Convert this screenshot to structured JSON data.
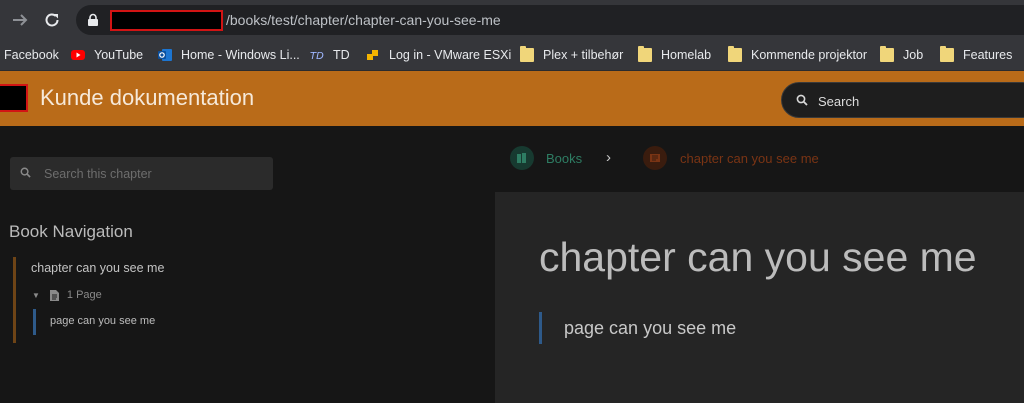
{
  "browser": {
    "url_path": "/books/test/chapter/chapter-can-you-see-me",
    "bookmarks": [
      {
        "label": "Facebook",
        "icon": "none"
      },
      {
        "label": "YouTube",
        "icon": "youtube-icon"
      },
      {
        "label": "Home - Windows Li...",
        "icon": "outlook-icon"
      },
      {
        "label": "TD",
        "icon": "td-icon"
      },
      {
        "label": "Log in - VMware ESXi",
        "icon": "vmware-icon"
      },
      {
        "label": "Plex + tilbehør",
        "icon": "folder-icon"
      },
      {
        "label": "Homelab",
        "icon": "folder-icon"
      },
      {
        "label": "Kommende projektor",
        "icon": "folder-icon"
      },
      {
        "label": "Job",
        "icon": "folder-icon"
      },
      {
        "label": "Features",
        "icon": "folder-icon"
      }
    ]
  },
  "header": {
    "title": "Kunde dokumentation",
    "search_placeholder": "Search",
    "accent_color": "#b96b19"
  },
  "sidebar": {
    "search_placeholder": "Search this chapter",
    "nav_title": "Book Navigation",
    "chapter_label": "chapter can you see me",
    "page_count": "1 Page",
    "page_label": "page can you see me"
  },
  "breadcrumb": {
    "books_label": "Books",
    "chapter_label": "chapter can you see me"
  },
  "content": {
    "chapter_title": "chapter can you see me",
    "page_link": "page can you see me"
  },
  "colors": {
    "books_green": "#2e7d63",
    "chapter_brown": "#7a3414",
    "page_blue": "#2e5a8a"
  }
}
